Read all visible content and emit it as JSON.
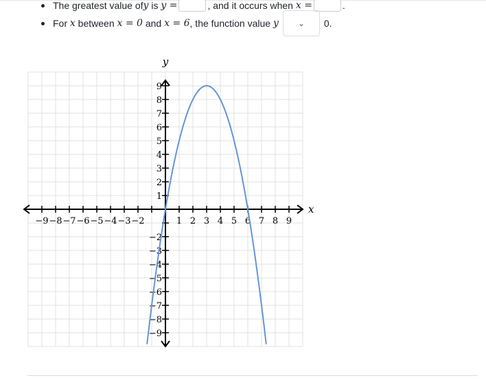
{
  "questions": [
    {
      "prefix": "The greatest value of ",
      "var_y": "y",
      "mid": " is ",
      "var_y2": "y =",
      "sep": ", and it occurs when ",
      "var_x": "x =",
      "end": "."
    },
    {
      "prefix": "For ",
      "var_x": "x",
      "mid": " between ",
      "cond1": "x = 0",
      "and": " and ",
      "cond2": "x = 6",
      "tail": ", the function value ",
      "var_y": "y",
      "after": " 0."
    }
  ],
  "dropdown": {
    "icon": "chevron-down-icon",
    "selected": ""
  },
  "graph": {
    "x_label": "x",
    "y_label": "y",
    "x_range": [
      -10,
      10
    ],
    "y_range": [
      -10,
      10
    ],
    "x_tick_labels": [
      "−9",
      "−8",
      "−7",
      "−6",
      "−5",
      "−4",
      "−3",
      "−2",
      "1",
      "2",
      "3",
      "4",
      "5",
      "6",
      "7",
      "8",
      "9"
    ],
    "x_tick_values": [
      -9,
      -8,
      -7,
      -6,
      -5,
      -4,
      -3,
      -2,
      1,
      2,
      3,
      4,
      5,
      6,
      7,
      8,
      9
    ],
    "y_tick_labels": [
      "9",
      "8",
      "7",
      "6",
      "5",
      "4",
      "3",
      "2",
      "1",
      "−2",
      "−3",
      "−4",
      "−5",
      "−6",
      "−7",
      "−8",
      "−9"
    ],
    "y_tick_values": [
      9,
      8,
      7,
      6,
      5,
      4,
      3,
      2,
      1,
      -2,
      -3,
      -4,
      -5,
      -6,
      -7,
      -8,
      -9
    ],
    "curve": {
      "type": "parabola",
      "vertex": [
        3,
        9
      ],
      "roots": [
        0,
        6
      ],
      "color": "#6495d6"
    },
    "grid": true
  }
}
